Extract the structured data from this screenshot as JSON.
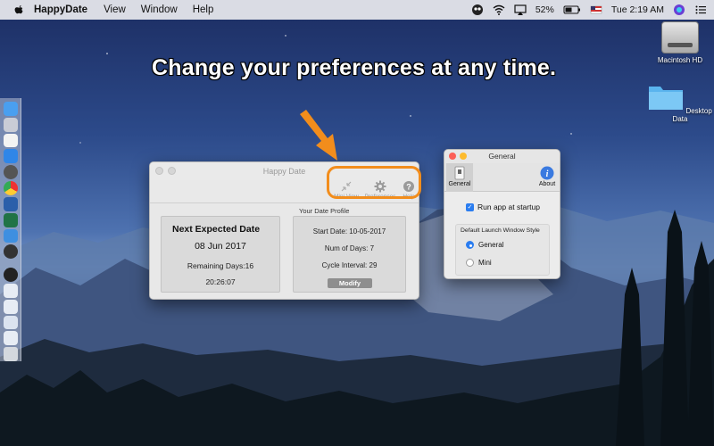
{
  "menubar": {
    "app_name": "HappyDate",
    "menus": [
      "View",
      "Window",
      "Help"
    ],
    "battery": "52%",
    "clock": "Tue 2:19 AM"
  },
  "headline": "Change your preferences at any time.",
  "desktop_icons": [
    {
      "label": "Macintosh HD",
      "icon": "hard-drive-icon"
    },
    {
      "label": "Desktop Data",
      "icon": "folder-icon"
    }
  ],
  "main_window": {
    "title": "Happy Date",
    "toolbar": {
      "mini_view": "Mini View",
      "preferences": "Preferences",
      "help": "Help"
    },
    "next_label": "Next Expected Date",
    "next_date": "08 Jun 2017",
    "remaining": "Remaining Days:16",
    "countdown": "20:26:07",
    "profile_label": "Your Date Profile",
    "start_date": "Start Date: 10-05-2017",
    "num_days": "Num of Days: 7",
    "cycle_interval": "Cycle Interval: 29",
    "modify": "Modify"
  },
  "general_window": {
    "title": "General",
    "tabs": {
      "general": "General",
      "about": "About"
    },
    "run_at_startup": "Run app at startup",
    "style_label": "Default Launch Window Style",
    "options": {
      "general": "General",
      "mini": "Mini"
    }
  },
  "colors": {
    "accent": "#2b7df0",
    "highlight": "#f28d1c"
  }
}
